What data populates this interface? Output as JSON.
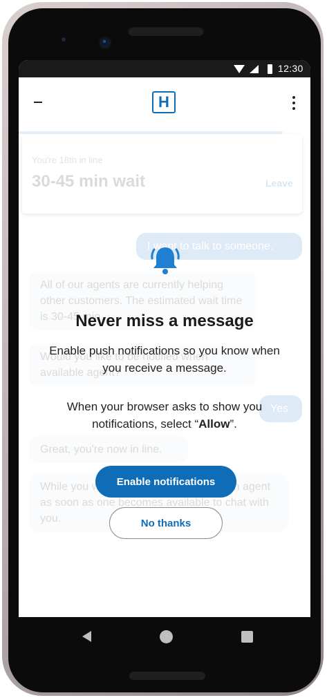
{
  "status_bar": {
    "time": "12:30"
  },
  "header": {
    "logo_text": "H"
  },
  "queue": {
    "position_text": "You're 18th in line",
    "wait_text": "30-45 min wait",
    "leave_label": "Leave"
  },
  "chat": {
    "messages": [
      {
        "role": "user",
        "text": "I want to talk to someone."
      },
      {
        "role": "agent",
        "text": "All of our agents are currently helping other customers. The estimated wait time is 30-45 min."
      },
      {
        "role": "agent",
        "text": "Would you like to be notified when available agent?"
      },
      {
        "role": "user",
        "text": "Yes"
      },
      {
        "role": "agent",
        "text": "Great, you're now in line."
      },
      {
        "role": "agent",
        "text": "While you wait, you'll be connected to an agent as soon as one becomes available to chat with you."
      }
    ]
  },
  "modal": {
    "icon": "bell-icon",
    "title": "Never miss a message",
    "description": "Enable push notifications so you know when you receive a message.",
    "browser_prefix": "When your browser asks to show you notifications, select “",
    "browser_bold": "Allow",
    "browser_suffix": "”.",
    "enable_label": "Enable notifications",
    "no_thanks_label": "No thanks"
  },
  "colors": {
    "accent": "#0f6db8",
    "bell": "#1f7fd1"
  }
}
